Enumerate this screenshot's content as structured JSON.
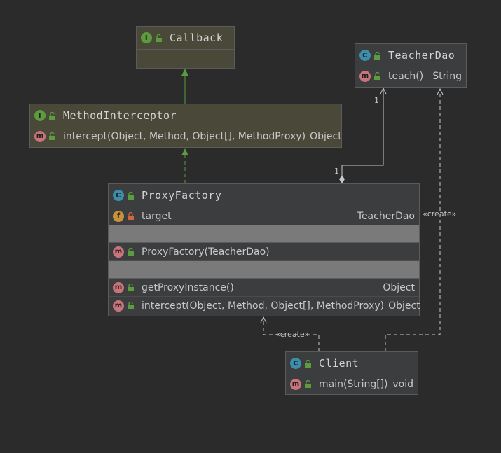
{
  "classes": {
    "callback": {
      "name": "Callback",
      "kind": "I"
    },
    "method_interceptor": {
      "name": "MethodInterceptor",
      "kind": "I",
      "methods": [
        {
          "name": "intercept(Object, Method, Object[], MethodProxy)",
          "type": "Object"
        }
      ]
    },
    "teacher_dao": {
      "name": "TeacherDao",
      "kind": "C",
      "methods": [
        {
          "name": "teach()",
          "type": "String"
        }
      ]
    },
    "proxy_factory": {
      "name": "ProxyFactory",
      "kind": "C",
      "fields": [
        {
          "name": "target",
          "type": "TeacherDao"
        }
      ],
      "constructors": [
        {
          "name": "ProxyFactory(TeacherDao)"
        }
      ],
      "methods": [
        {
          "name": "getProxyInstance()",
          "type": "Object"
        },
        {
          "name": "intercept(Object, Method, Object[], MethodProxy)",
          "type": "Object"
        }
      ]
    },
    "client": {
      "name": "Client",
      "kind": "C",
      "methods": [
        {
          "name": "main(String[])",
          "type": "void"
        }
      ]
    }
  },
  "badges": {
    "interface": "I",
    "class": "C",
    "method": "m",
    "field": "f"
  },
  "labels": {
    "assoc_end_teacher": "1",
    "assoc_end_proxy": "1",
    "create_teacher": "«create»",
    "create_proxy": "«create»"
  },
  "colors": {
    "background": "#2b2b2b",
    "interface_header": "#4a4839",
    "class_header": "#3b3d3f",
    "realization_green": "#5d9b3f",
    "line": "#c8c8c8"
  }
}
